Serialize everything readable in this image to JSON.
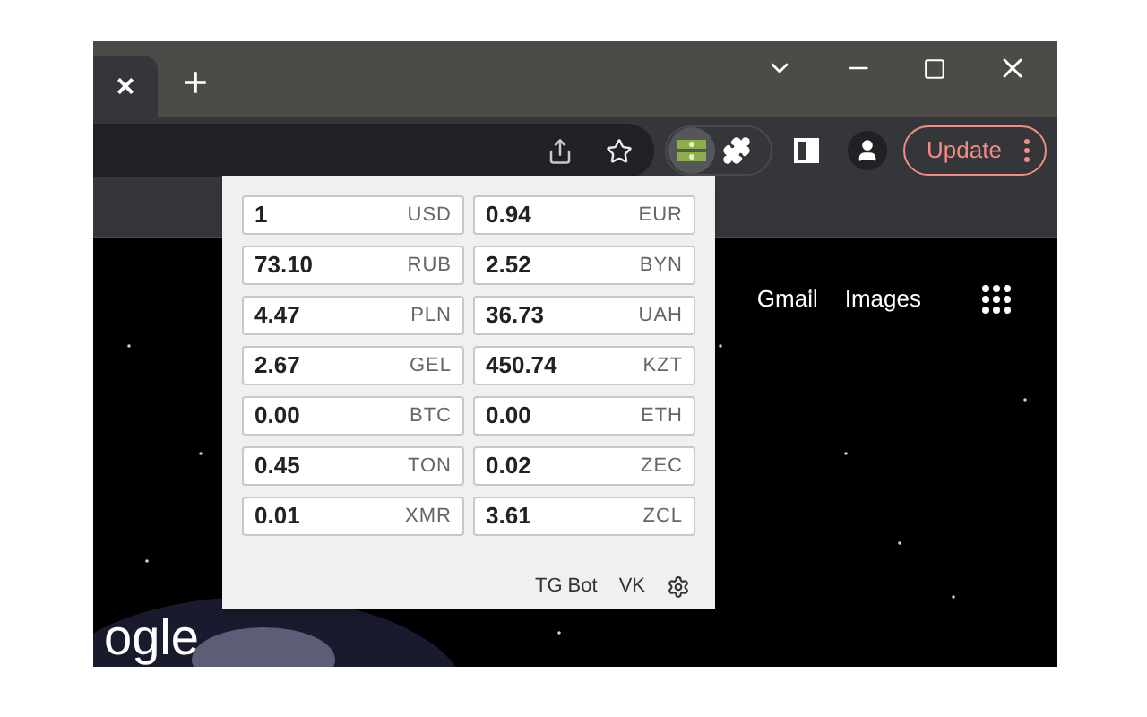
{
  "tab_strip": {
    "close_tab": "×",
    "new_tab": "+"
  },
  "toolbar": {
    "update_button": "Update",
    "extension_active": true
  },
  "page": {
    "links": [
      "Gmail",
      "Images"
    ],
    "logo_text": "ogle"
  },
  "popup": {
    "rates": [
      {
        "value": "1",
        "currency": "USD"
      },
      {
        "value": "0.94",
        "currency": "EUR"
      },
      {
        "value": "73.10",
        "currency": "RUB"
      },
      {
        "value": "2.52",
        "currency": "BYN"
      },
      {
        "value": "4.47",
        "currency": "PLN"
      },
      {
        "value": "36.73",
        "currency": "UAH"
      },
      {
        "value": "2.67",
        "currency": "GEL"
      },
      {
        "value": "450.74",
        "currency": "KZT"
      },
      {
        "value": "0.00",
        "currency": "BTC"
      },
      {
        "value": "0.00",
        "currency": "ETH"
      },
      {
        "value": "0.45",
        "currency": "TON"
      },
      {
        "value": "0.02",
        "currency": "ZEC"
      },
      {
        "value": "0.01",
        "currency": "XMR"
      },
      {
        "value": "3.61",
        "currency": "ZCL"
      }
    ],
    "footer_links": [
      "TG Bot",
      "VK"
    ]
  }
}
